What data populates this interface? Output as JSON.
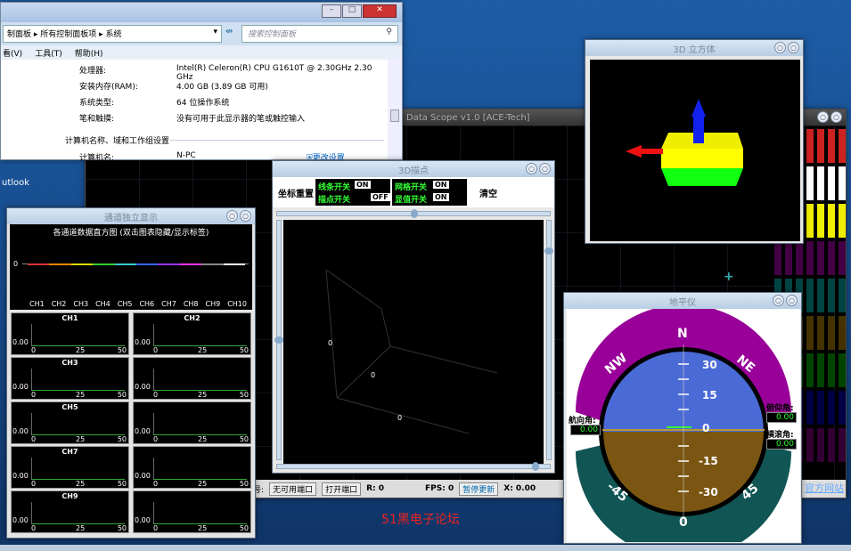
{
  "explorer": {
    "address": "制面板 ▸ 所有控制面板项 ▸ 系统",
    "search_placeholder": "搜索控制面板",
    "menu": [
      "看(V)",
      "工具(T)",
      "帮助(H)"
    ],
    "rows": [
      {
        "k": "处理器:",
        "v": "Intel(R) Celeron(R) CPU G1610T @ 2.30GHz   2.30 GHz"
      },
      {
        "k": "安装内存(RAM):",
        "v": "4.00 GB (3.89 GB 可用)"
      },
      {
        "k": "系统类型:",
        "v": "64 位操作系统"
      },
      {
        "k": "笔和触摸:",
        "v": "没有可用于此显示器的笔或触控输入"
      }
    ],
    "section": "计算机名称、域和工作组设置",
    "pc_label": "计算机名:",
    "pc_value": "N-PC",
    "change": "更改设置"
  },
  "desktop": {
    "outlook": "utlook",
    "watermark": "51黑电子论坛",
    "official": "官方网站"
  },
  "scope": {
    "title": "Data Scope  v1.0   [ACE-Tech]",
    "port_label": "号:",
    "port_value": "无可用端口",
    "open": "打开端口",
    "r": "R: 0",
    "fps": "FPS: 0",
    "pause": "暂停更新",
    "x": "X: 0.00"
  },
  "hist": {
    "title": "通道独立显示",
    "chart_title": "各通道数据直方图   (双击图表隐藏/显示标签)",
    "zero": "0",
    "channels": [
      "CH1",
      "CH2",
      "CH3",
      "CH4",
      "CH5",
      "CH6",
      "CH7",
      "CH8",
      "CH9",
      "CH10"
    ],
    "ch_colors": [
      "#d33",
      "#e80",
      "#dd0",
      "#3c3",
      "#3cc",
      "#36f",
      "#93f",
      "#f3f",
      "#888",
      "#fff"
    ],
    "y0": "0.00",
    "x0": "0",
    "x25": "25",
    "x50": "50"
  },
  "plot3d": {
    "title": "3D描点",
    "reset": "坐标重置",
    "line_sw": "线条开关",
    "line_v": "ON",
    "point_sw": "描点开关",
    "point_v": "OFF",
    "grid_sw": "网格开关",
    "grid_v": "ON",
    "val_sw": "显值开关",
    "val_v": "ON",
    "clear": "清空",
    "axis0a": "0",
    "axis0b": "0",
    "axis0c": "0"
  },
  "cube": {
    "title": "3D 立方体"
  },
  "horizon": {
    "title": "地平仪",
    "n": "N",
    "nw": "NW",
    "ne": "NE",
    "ticks": [
      "30",
      "15",
      "0",
      "-15",
      "-30"
    ],
    "bottom": [
      "-45",
      "0",
      "45"
    ],
    "heading_lbl": "航向角:",
    "heading_v": "0.00",
    "pitch_lbl": "俯仰角:",
    "pitch_v": "0.00",
    "roll_lbl": "横滚角:",
    "roll_v": "0.00"
  }
}
